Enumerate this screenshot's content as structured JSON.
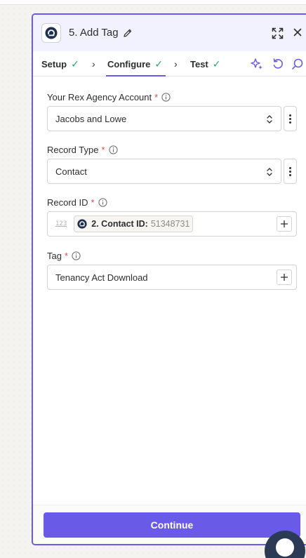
{
  "header": {
    "title": "5. Add Tag",
    "icons": [
      "app-logo-icon",
      "pencil-icon",
      "expand-icon",
      "close-icon"
    ]
  },
  "tabs": [
    {
      "label": "Setup",
      "done": true
    },
    {
      "label": "Configure",
      "done": true,
      "active": true
    },
    {
      "label": "Test",
      "done": true
    }
  ],
  "toolbar_icons": [
    "ai-sparkle-icon",
    "undo-icon",
    "search-icon"
  ],
  "fields": {
    "account": {
      "label": "Your Rex Agency Account",
      "required": "*",
      "value": "Jacobs and Lowe"
    },
    "record_type": {
      "label": "Record Type",
      "required": "*",
      "value": "Contact"
    },
    "record_id": {
      "label": "Record ID",
      "required": "*",
      "type_hint": "123",
      "pill_key": "2. Contact ID:",
      "pill_value": "51348731"
    },
    "tag": {
      "label": "Tag",
      "required": "*",
      "value": "Tenancy Act Download"
    }
  },
  "footer": {
    "continue_label": "Continue"
  },
  "colors": {
    "accent": "#695be8",
    "success": "#2f9e6b",
    "required": "#e5484d",
    "header_bg": "#f2f1fe"
  }
}
